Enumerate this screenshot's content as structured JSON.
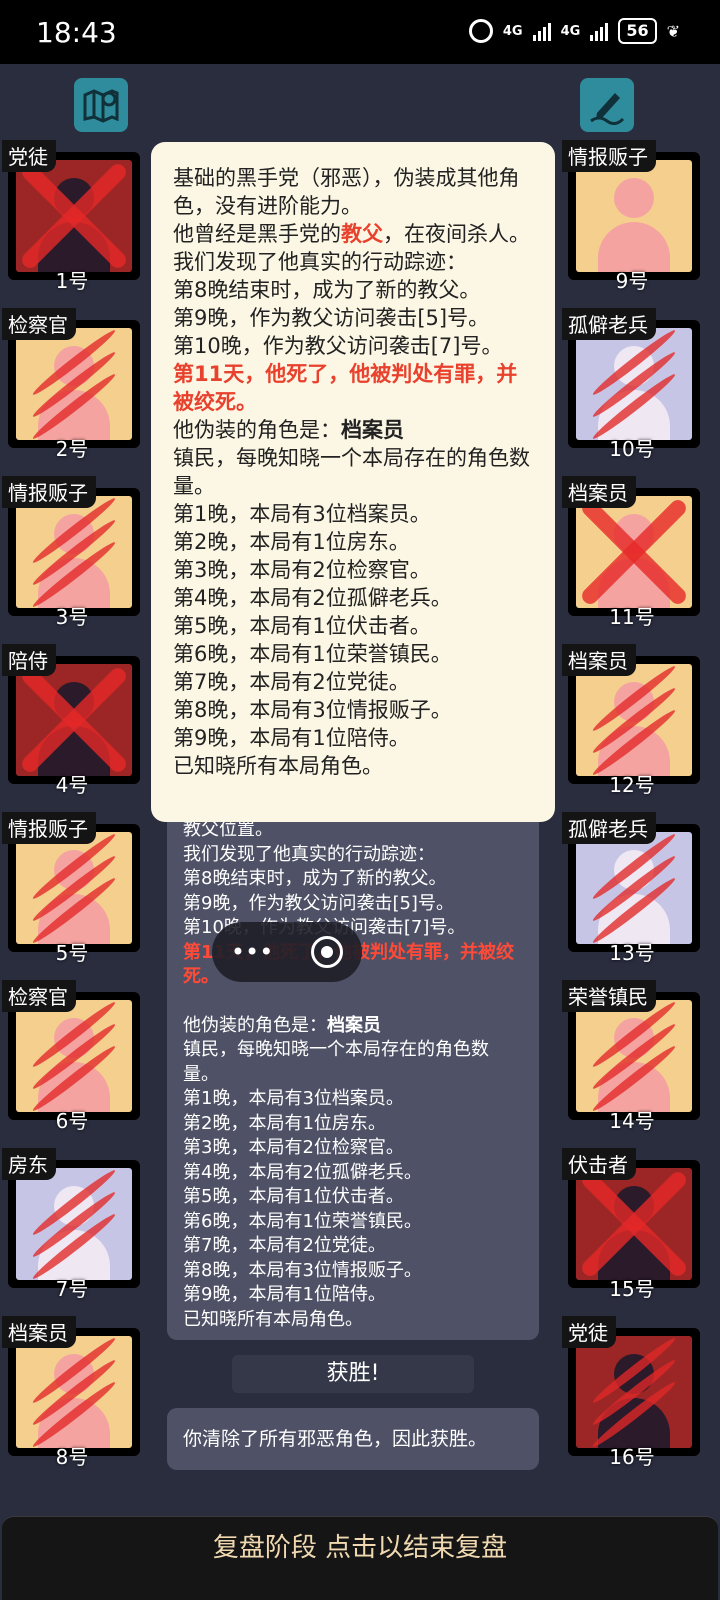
{
  "status_bar": {
    "time": "18:43",
    "signal1": "4G",
    "signal2": "4G",
    "battery": "56"
  },
  "left_players": [
    {
      "role": "党徒",
      "seat": "1号",
      "color": "red",
      "dead": "x"
    },
    {
      "role": "检察官",
      "seat": "2号",
      "color": "yellow",
      "dead": "claw"
    },
    {
      "role": "情报贩子",
      "seat": "3号",
      "color": "yellow",
      "dead": "claw"
    },
    {
      "role": "陪侍",
      "seat": "4号",
      "color": "red",
      "dead": "x"
    },
    {
      "role": "情报贩子",
      "seat": "5号",
      "color": "yellow",
      "dead": "claw"
    },
    {
      "role": "检察官",
      "seat": "6号",
      "color": "yellow",
      "dead": "claw"
    },
    {
      "role": "房东",
      "seat": "7号",
      "color": "lav",
      "dead": "claw"
    },
    {
      "role": "档案员",
      "seat": "8号",
      "color": "yellow",
      "dead": "claw"
    }
  ],
  "right_players": [
    {
      "role": "情报贩子",
      "seat": "9号",
      "color": "yellow",
      "dead": "none"
    },
    {
      "role": "孤僻老兵",
      "seat": "10号",
      "color": "lav",
      "dead": "claw"
    },
    {
      "role": "档案员",
      "seat": "11号",
      "color": "yellow",
      "dead": "x"
    },
    {
      "role": "档案员",
      "seat": "12号",
      "color": "yellow",
      "dead": "claw"
    },
    {
      "role": "孤僻老兵",
      "seat": "13号",
      "color": "lav",
      "dead": "claw"
    },
    {
      "role": "荣誉镇民",
      "seat": "14号",
      "color": "yellow",
      "dead": "claw"
    },
    {
      "role": "伏击者",
      "seat": "15号",
      "color": "red",
      "dead": "x"
    },
    {
      "role": "党徒",
      "seat": "16号",
      "color": "red",
      "dead": "claw"
    }
  ],
  "popup": {
    "l1": "基础的黑手党（邪恶），伪装成其他角色，没有进阶能力。",
    "l2a": "他曾经是黑手党的",
    "l2b": "教父",
    "l2c": "，在夜间杀人。",
    "l3": "我们发现了他真实的行动踪迹：",
    "l4": "第8晚结束时，成为了新的教父。",
    "l5": "第9晚，作为教父访问袭击[5]号。",
    "l6": "第10晚，作为教父访问袭击[7]号。",
    "l7": "第11天，他死了，他被判处有罪，并被绞死。",
    "l8a": "他伪装的角色是：",
    "l8b": "档案员",
    "l9": "镇民，每晚知晓一个本局存在的角色数量。",
    "nights": [
      "第1晚，本局有3位档案员。",
      "第2晚，本局有1位房东。",
      "第3晚，本局有2位检察官。",
      "第4晚，本局有2位孤僻老兵。",
      "第5晚，本局有1位伏击者。",
      "第6晚，本局有1位荣誉镇民。",
      "第7晚，本局有2位党徒。",
      "第8晚，本局有3位情报贩子。",
      "第9晚，本局有1位陪侍。"
    ],
    "last": "已知晓所有本局角色。"
  },
  "back_panel": {
    "l0": "教父位置。",
    "l1": "我们发现了他真实的行动踪迹：",
    "l2": "第8晚结束时，成为了新的教父。",
    "l3": "第9晚，作为教父访问袭击[5]号。",
    "l4": "第10晚，作为教父访问袭击[7]号。",
    "l5": "第11天，他死了，他被判处有罪，并被绞死。",
    "l6a": "他伪装的角色是：",
    "l6b": "档案员",
    "l7": "镇民，每晚知晓一个本局存在的角色数量。",
    "nights": [
      "第1晚，本局有3位档案员。",
      "第2晚，本局有1位房东。",
      "第3晚，本局有2位检察官。",
      "第4晚，本局有2位孤僻老兵。",
      "第5晚，本局有1位伏击者。",
      "第6晚，本局有1位荣誉镇民。",
      "第7晚，本局有2位党徒。",
      "第8晚，本局有3位情报贩子。",
      "第9晚，本局有1位陪侍。"
    ],
    "last": "已知晓所有本局角色。"
  },
  "mini_pill": {
    "dots": "•••"
  },
  "win_button": "获胜!",
  "result_text": "你清除了所有邪恶角色，因此获胜。",
  "bottom_bar": "复盘阶段 点击以结束复盘",
  "icons": {
    "left_top": "map-icon",
    "right_top": "notes-pen-icon"
  }
}
